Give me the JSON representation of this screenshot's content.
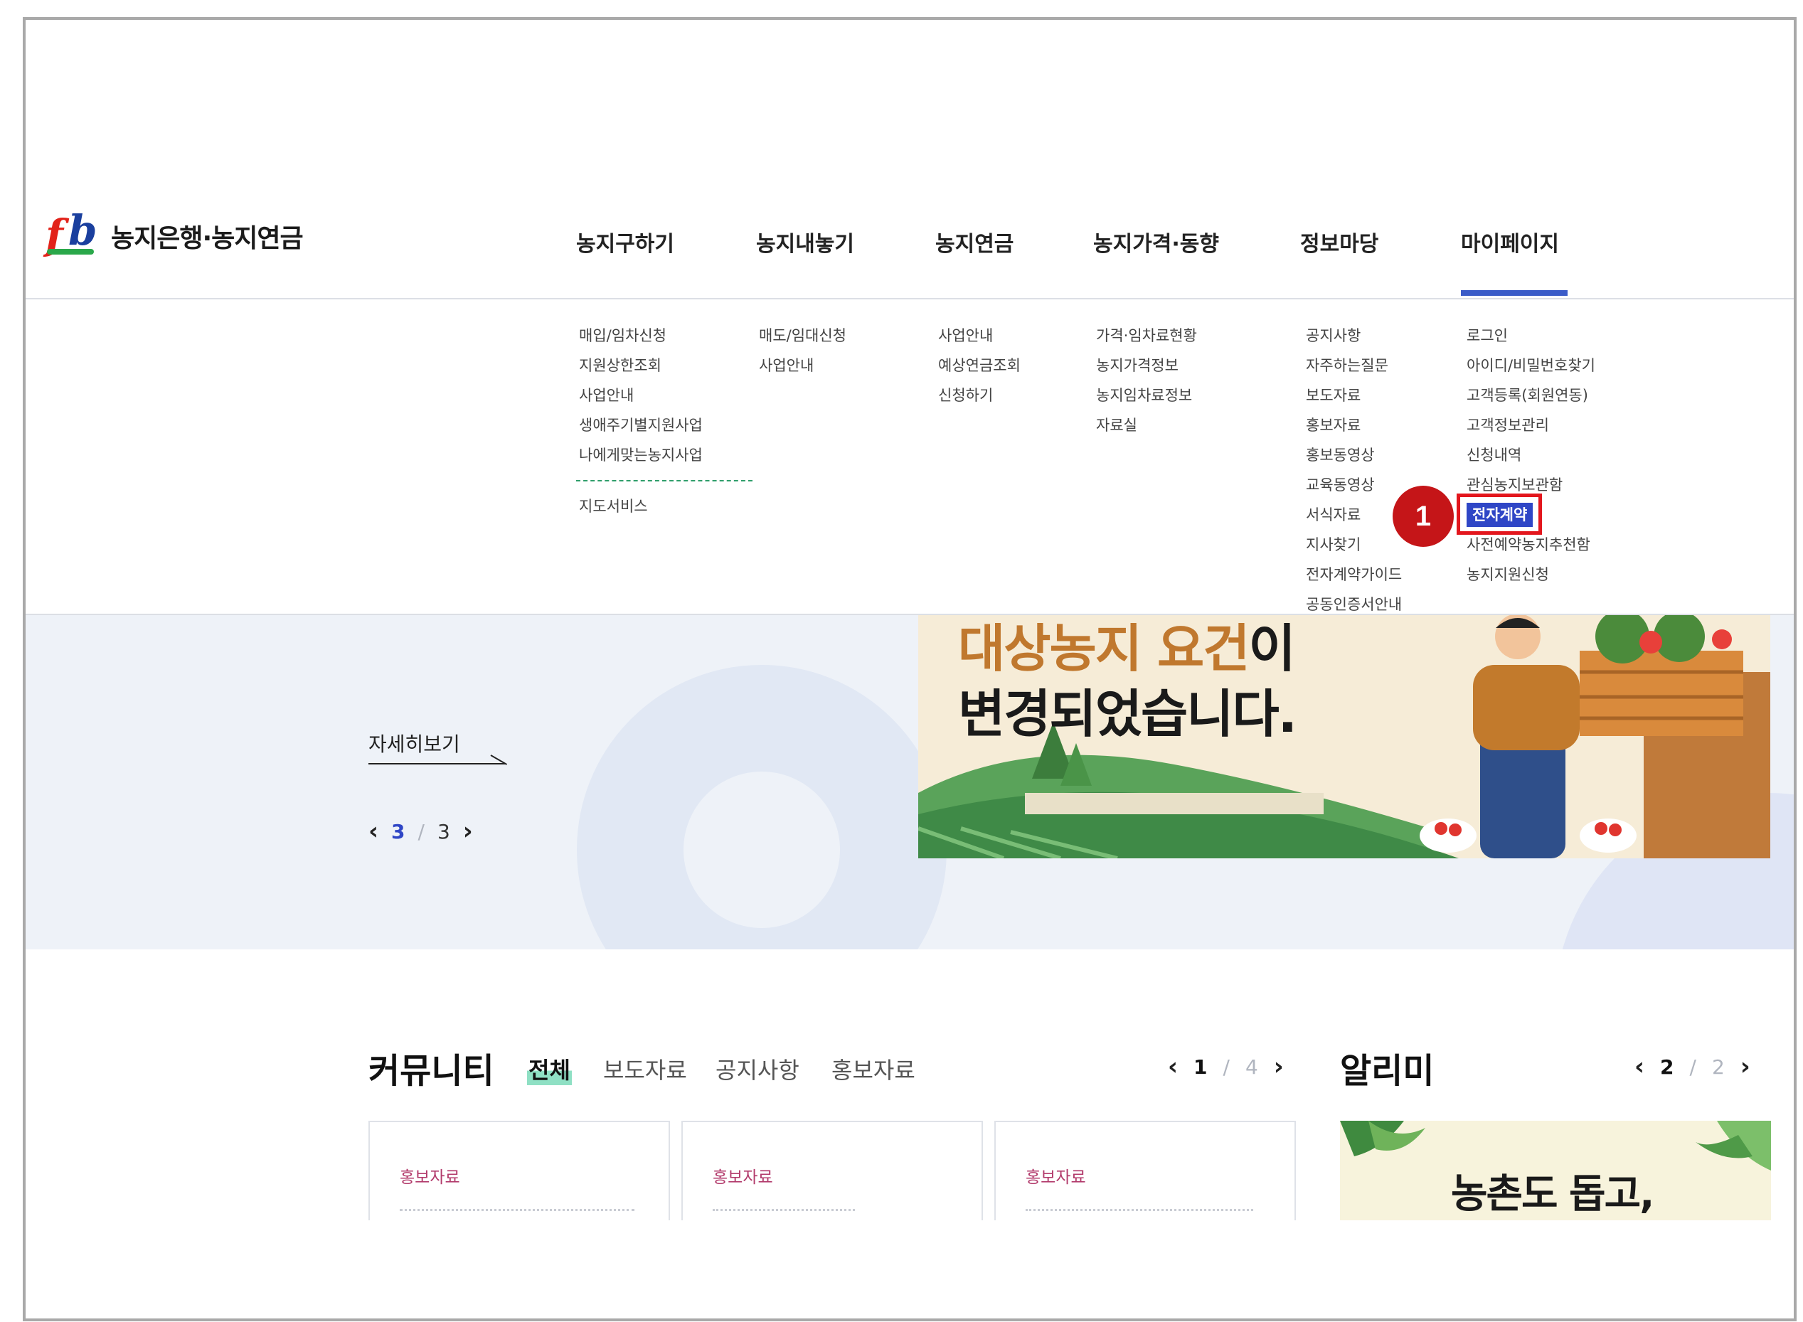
{
  "logo": {
    "text": "농지은행·농지연금"
  },
  "gnb": {
    "items": [
      "농지구하기",
      "농지내놓기",
      "농지연금",
      "농지가격·동향",
      "정보마당",
      "마이페이지"
    ],
    "active": "마이페이지"
  },
  "mega_menu": {
    "col1": [
      "매입/임차신청",
      "지원상한조회",
      "사업안내",
      "생애주기별지원사업",
      "나에게맞는농지사업"
    ],
    "col1_extra": [
      "지도서비스"
    ],
    "col2": [
      "매도/임대신청",
      "사업안내"
    ],
    "col3": [
      "사업안내",
      "예상연금조회",
      "신청하기"
    ],
    "col4": [
      "가격·임차료현황",
      "농지가격정보",
      "농지임차료정보",
      "자료실"
    ],
    "col5": [
      "공지사항",
      "자주하는질문",
      "보도자료",
      "홍보자료",
      "홍보동영상",
      "교육동영상",
      "서식자료",
      "지사찾기",
      "전자계약가이드",
      "공동인증서안내"
    ],
    "col6_before": [
      "로그인",
      "아이디/비밀번호찾기",
      "고객등록(회원연동)",
      "고객정보관리",
      "신청내역",
      "관심농지보관함"
    ],
    "col6_highlight": "전자계약",
    "col6_after": [
      "사전예약농지추천함",
      "농지지원신청"
    ]
  },
  "annotation": {
    "step": "1"
  },
  "hero": {
    "more_label": "자세히보기",
    "pager": {
      "current": "3",
      "separator": "/",
      "total": "3"
    },
    "banner": {
      "line1_highlight": "대상농지 요건",
      "line1_rest": "이",
      "line2": "변경되었습니다."
    }
  },
  "community": {
    "title": "커뮤니티",
    "tabs": [
      "전체",
      "보도자료",
      "공지사항",
      "홍보자료"
    ],
    "pager": {
      "current": "1",
      "separator": "/",
      "total": "4"
    },
    "cards": [
      {
        "tag": "홍보자료"
      },
      {
        "tag": "홍보자료"
      },
      {
        "tag": "홍보자료"
      }
    ]
  },
  "notice": {
    "title": "알리미",
    "pager": {
      "current": "2",
      "separator": "/",
      "total": "2"
    },
    "banner_text": "농촌도 돕고,"
  },
  "colors": {
    "accent": "#3b5cc8",
    "highlight_red": "#e3161d",
    "badge_red": "#c51518",
    "tag_pink": "#b23a6b"
  },
  "icons": {
    "prev": "chevron-left-icon",
    "next": "chevron-right-icon",
    "more": "arrow-diagonal-icon"
  }
}
